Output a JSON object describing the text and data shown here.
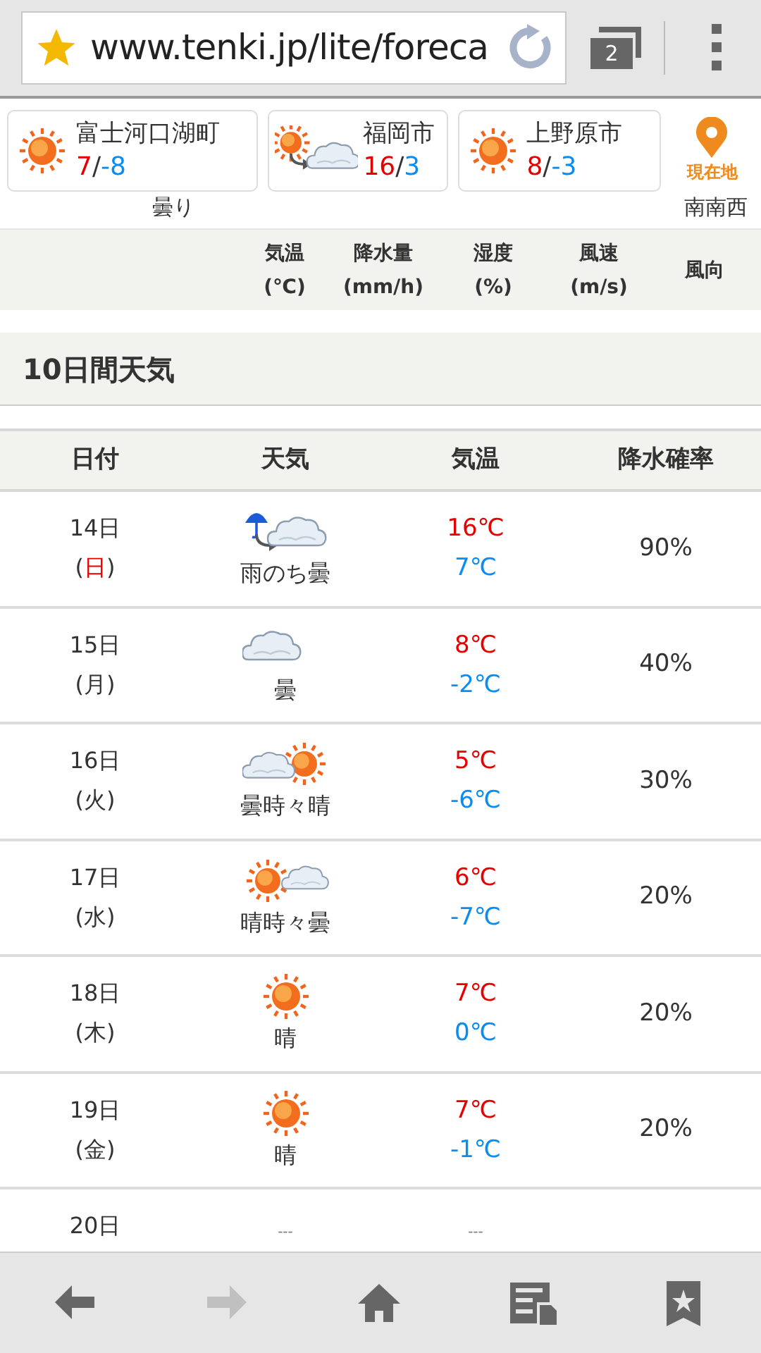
{
  "browser": {
    "url": "www.tenki.jp/lite/foreca",
    "tab_count": "2"
  },
  "locations": [
    {
      "name": "富士河口湖町",
      "kind": "sun",
      "high": "7",
      "separator": "/",
      "low": "-8"
    },
    {
      "name": "福岡市",
      "kind": "sun-then-cloud",
      "high": "16",
      "separator": "/",
      "low": "3"
    },
    {
      "name": "上野原市",
      "kind": "sun",
      "high": "8",
      "separator": "/",
      "low": "-3"
    }
  ],
  "current_location": {
    "label": "現在地"
  },
  "hourly_row": {
    "weather": "曇り",
    "wind_direction": "南南西"
  },
  "hourly_header": [
    "気温\n(℃)",
    "降水量\n(mm/h)",
    "湿度\n(%)",
    "風速\n(m/s)",
    "風向"
  ],
  "ten_day": {
    "title": "10日間天気",
    "columns": [
      "日付",
      "天気",
      "気温",
      "降水確率"
    ],
    "rows": [
      {
        "day": "14日",
        "weekday": "(日)",
        "holiday": true,
        "kind": "rain-then-cloud",
        "weather": "雨のち曇",
        "high": "16℃",
        "low": "7℃",
        "precip": "90%"
      },
      {
        "day": "15日",
        "weekday": "(月)",
        "holiday": false,
        "kind": "cloud",
        "weather": "曇",
        "high": "8℃",
        "low": "-2℃",
        "precip": "40%"
      },
      {
        "day": "16日",
        "weekday": "(火)",
        "holiday": false,
        "kind": "cloud-sometimes-sun",
        "weather": "曇時々晴",
        "high": "5℃",
        "low": "-6℃",
        "precip": "30%"
      },
      {
        "day": "17日",
        "weekday": "(水)",
        "holiday": false,
        "kind": "sun-sometimes-cloud",
        "weather": "晴時々曇",
        "high": "6℃",
        "low": "-7℃",
        "precip": "20%"
      },
      {
        "day": "18日",
        "weekday": "(木)",
        "holiday": false,
        "kind": "sun",
        "weather": "晴",
        "high": "7℃",
        "low": "0℃",
        "precip": "20%"
      },
      {
        "day": "19日",
        "weekday": "(金)",
        "holiday": false,
        "kind": "sun",
        "weather": "晴",
        "high": "7℃",
        "low": "-1℃",
        "precip": "20%"
      }
    ],
    "partial_row": {
      "day": "20日",
      "weather": "---",
      "temp": "---"
    }
  },
  "toolbar": [
    {
      "kind": "back",
      "disabled": false
    },
    {
      "kind": "forward",
      "disabled": true
    },
    {
      "kind": "home",
      "disabled": false
    },
    {
      "kind": "reader",
      "disabled": false
    },
    {
      "kind": "bookmarks",
      "disabled": false
    }
  ]
}
